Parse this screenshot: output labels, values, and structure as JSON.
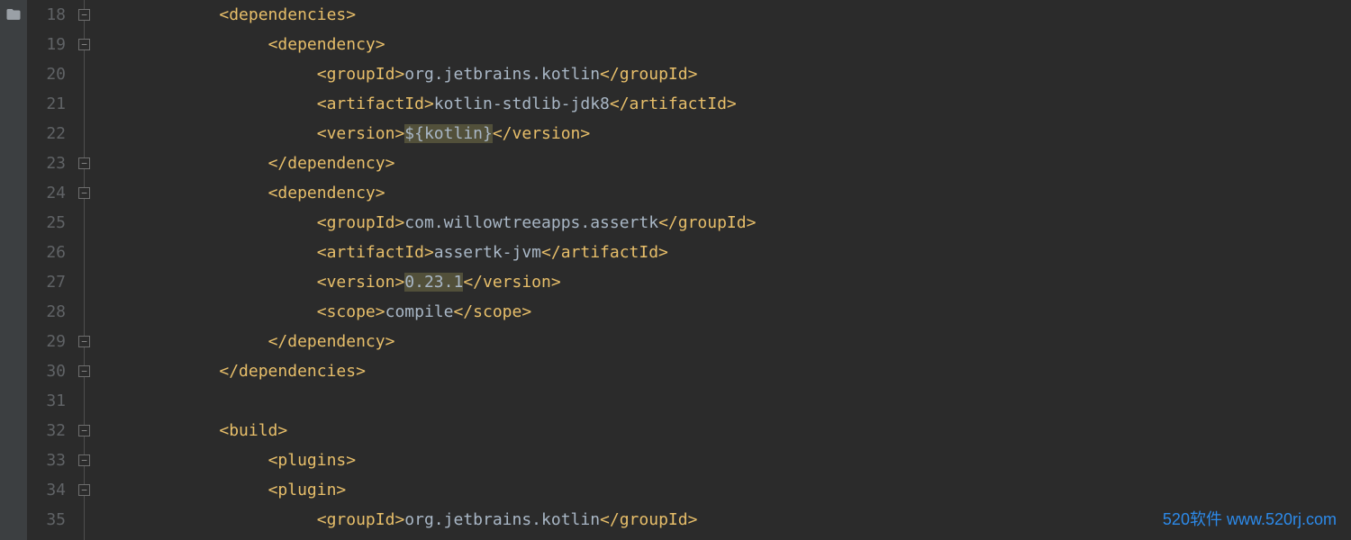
{
  "gutter_start": 18,
  "lines": [
    {
      "n": 18,
      "indent": 2,
      "fold": "open-down",
      "tokens": [
        {
          "t": "tag",
          "v": "<dependencies>"
        }
      ]
    },
    {
      "n": 19,
      "indent": 3,
      "fold": "open-down",
      "tokens": [
        {
          "t": "tag",
          "v": "<dependency>"
        }
      ]
    },
    {
      "n": 20,
      "indent": 4,
      "tokens": [
        {
          "t": "tag",
          "v": "<groupId>"
        },
        {
          "t": "text",
          "v": "org.jetbrains.kotlin"
        },
        {
          "t": "tag",
          "v": "</groupId>"
        }
      ]
    },
    {
      "n": 21,
      "indent": 4,
      "tokens": [
        {
          "t": "tag",
          "v": "<artifactId>"
        },
        {
          "t": "text",
          "v": "kotlin-stdlib-jdk8"
        },
        {
          "t": "tag",
          "v": "</artifactId>"
        }
      ]
    },
    {
      "n": 22,
      "indent": 4,
      "tokens": [
        {
          "t": "tag",
          "v": "<version>"
        },
        {
          "t": "hl-text",
          "v": "${kotlin}"
        },
        {
          "t": "tag",
          "v": "</version>"
        }
      ]
    },
    {
      "n": 23,
      "indent": 3,
      "fold": "close-up",
      "tokens": [
        {
          "t": "tag",
          "v": "</dependency>"
        }
      ]
    },
    {
      "n": 24,
      "indent": 3,
      "fold": "open-down",
      "tokens": [
        {
          "t": "tag",
          "v": "<dependency>"
        }
      ]
    },
    {
      "n": 25,
      "indent": 4,
      "tokens": [
        {
          "t": "tag",
          "v": "<groupId>"
        },
        {
          "t": "text",
          "v": "com.willowtreeapps.assertk"
        },
        {
          "t": "tag",
          "v": "</groupId>"
        }
      ]
    },
    {
      "n": 26,
      "indent": 4,
      "tokens": [
        {
          "t": "tag",
          "v": "<artifactId>"
        },
        {
          "t": "text",
          "v": "assertk-jvm"
        },
        {
          "t": "tag",
          "v": "</artifactId>"
        }
      ]
    },
    {
      "n": 27,
      "indent": 4,
      "tokens": [
        {
          "t": "tag",
          "v": "<version>"
        },
        {
          "t": "hl-text",
          "v": "0.23.1"
        },
        {
          "t": "tag",
          "v": "</version>"
        }
      ]
    },
    {
      "n": 28,
      "indent": 4,
      "tokens": [
        {
          "t": "tag",
          "v": "<scope>"
        },
        {
          "t": "text",
          "v": "compile"
        },
        {
          "t": "tag",
          "v": "</scope>"
        }
      ]
    },
    {
      "n": 29,
      "indent": 3,
      "fold": "close-up",
      "tokens": [
        {
          "t": "tag",
          "v": "</dependency>"
        }
      ]
    },
    {
      "n": 30,
      "indent": 2,
      "fold": "close-up",
      "tokens": [
        {
          "t": "tag",
          "v": "</dependencies>"
        }
      ]
    },
    {
      "n": 31,
      "indent": 0,
      "tokens": []
    },
    {
      "n": 32,
      "indent": 2,
      "fold": "open-down",
      "tokens": [
        {
          "t": "tag",
          "v": "<build>"
        }
      ]
    },
    {
      "n": 33,
      "indent": 3,
      "fold": "open-down",
      "tokens": [
        {
          "t": "tag",
          "v": "<plugins>"
        }
      ]
    },
    {
      "n": 34,
      "indent": 3,
      "fold": "open-down",
      "tokens": [
        {
          "t": "tag",
          "v": "<plugin>"
        }
      ]
    },
    {
      "n": 35,
      "indent": 4,
      "tokens": [
        {
          "t": "tag",
          "v": "<groupId>"
        },
        {
          "t": "text",
          "v": "org.jetbrains.kotlin"
        },
        {
          "t": "tag",
          "v": "</groupId>"
        }
      ]
    }
  ],
  "indent_unit": "     ",
  "watermark": "520软件 www.520rj.com"
}
